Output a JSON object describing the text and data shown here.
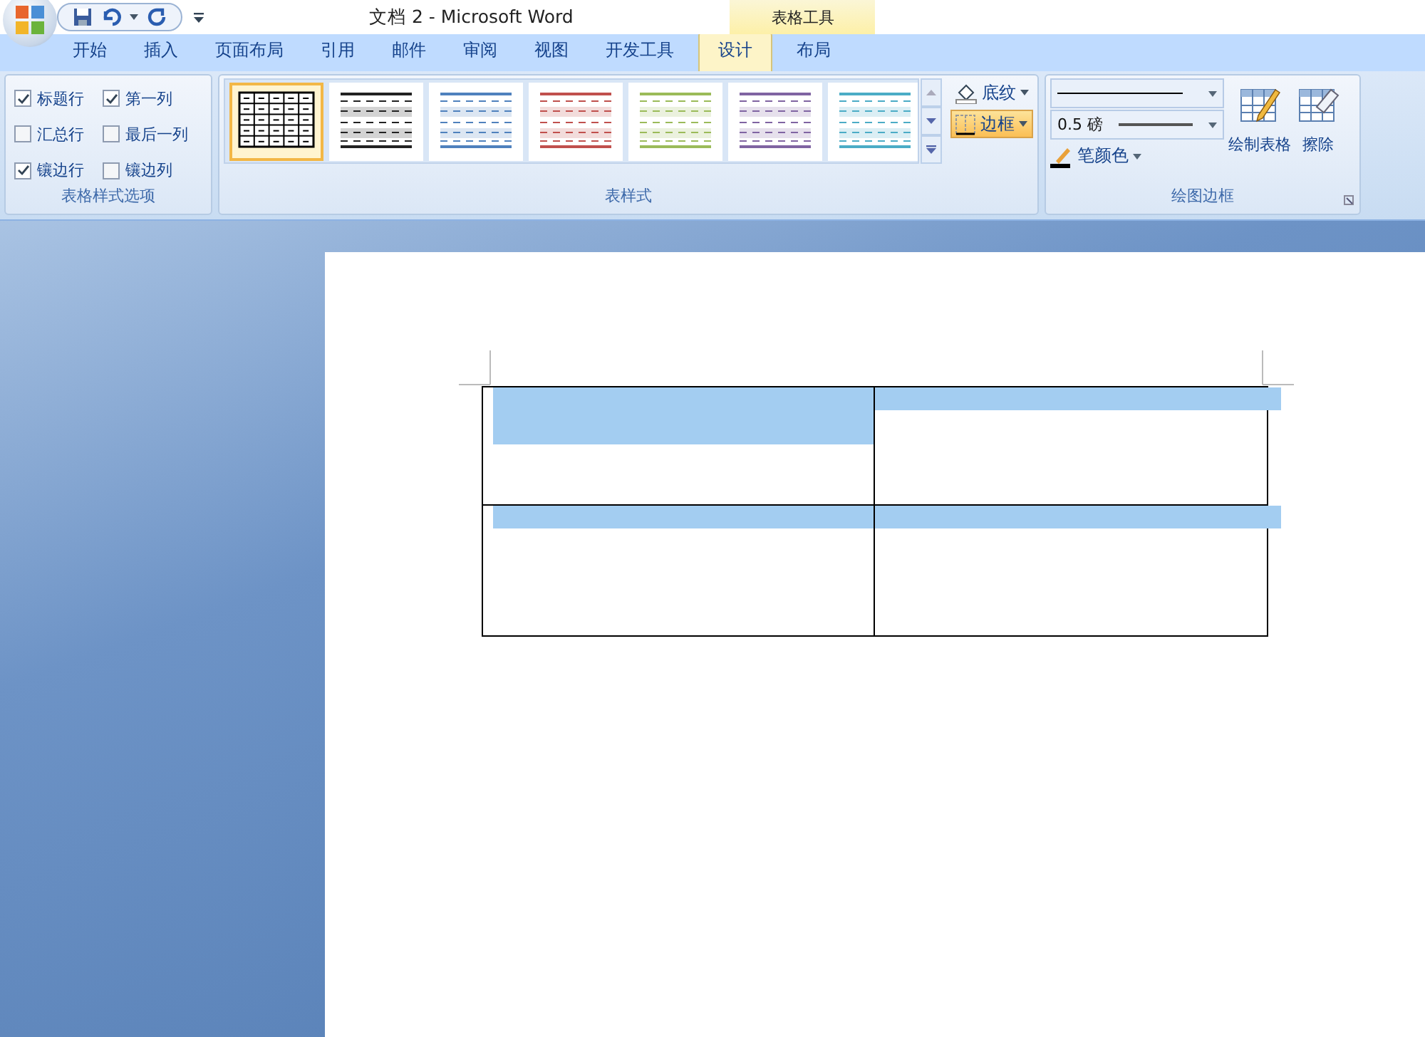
{
  "window": {
    "title": "文档 2 - Microsoft Word",
    "context_tab": "表格工具"
  },
  "tabs": [
    {
      "label": "开始",
      "selected": false
    },
    {
      "label": "插入",
      "selected": false
    },
    {
      "label": "页面布局",
      "selected": false
    },
    {
      "label": "引用",
      "selected": false
    },
    {
      "label": "邮件",
      "selected": false
    },
    {
      "label": "审阅",
      "selected": false
    },
    {
      "label": "视图",
      "selected": false
    },
    {
      "label": "开发工具",
      "selected": false
    },
    {
      "label": "设计",
      "selected": true
    },
    {
      "label": "布局",
      "selected": false
    }
  ],
  "style_options": {
    "label": "表格样式选项",
    "options": [
      {
        "label": "标题行",
        "checked": true
      },
      {
        "label": "第一列",
        "checked": true
      },
      {
        "label": "汇总行",
        "checked": false
      },
      {
        "label": "最后一列",
        "checked": false
      },
      {
        "label": "镶边行",
        "checked": true
      },
      {
        "label": "镶边列",
        "checked": false
      }
    ]
  },
  "table_styles": {
    "label": "表样式",
    "styles": [
      {
        "kind": "grid",
        "color": "#000000",
        "selected": true
      },
      {
        "kind": "banded",
        "color": "#222222",
        "selected": false
      },
      {
        "kind": "banded",
        "color": "#4f81bd",
        "selected": false
      },
      {
        "kind": "banded",
        "color": "#c0504d",
        "selected": false
      },
      {
        "kind": "banded",
        "color": "#9bbb59",
        "selected": false
      },
      {
        "kind": "banded",
        "color": "#8064a2",
        "selected": false
      },
      {
        "kind": "banded",
        "color": "#4bacc6",
        "selected": false
      }
    ],
    "shading": {
      "label": "底纹",
      "active": false
    },
    "borders": {
      "label": "边框",
      "active": true
    }
  },
  "draw_borders": {
    "label": "绘图边框",
    "weight": "0.5 磅",
    "pen_color": "笔颜色",
    "draw_table": "绘制表格",
    "eraser": "擦除"
  },
  "document": {
    "table": [
      [
        {
          "selected": true
        },
        {
          "selected": true
        }
      ],
      [
        {
          "selected": true
        },
        {
          "selected": true
        }
      ]
    ]
  }
}
